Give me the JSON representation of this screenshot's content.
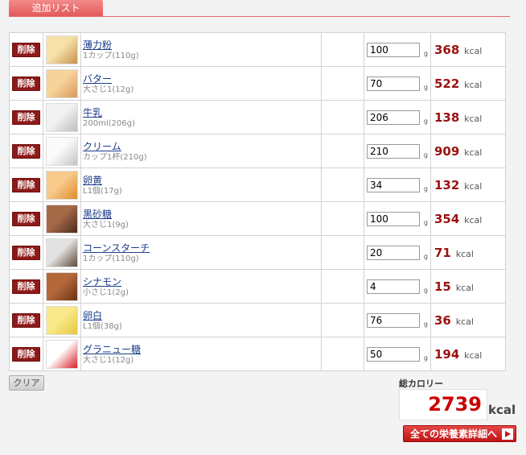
{
  "header": {
    "tab_label": "追加リスト"
  },
  "row_labels": {
    "delete": "削除",
    "unit": "g",
    "kcal_unit": "kcal"
  },
  "items": [
    {
      "name": "薄力粉",
      "sub": "1カップ(110g)",
      "qty": "100",
      "kcal": "368",
      "icon": "flour-bag-icon",
      "colors": [
        "#f6e1a9",
        "#c8914a"
      ]
    },
    {
      "name": "バター",
      "sub": "大さじ1(12g)",
      "qty": "70",
      "kcal": "522",
      "icon": "butter-icon",
      "colors": [
        "#f7d39c",
        "#d99a5b"
      ]
    },
    {
      "name": "牛乳",
      "sub": "200ml(206g)",
      "qty": "206",
      "kcal": "138",
      "icon": "milk-icon",
      "colors": [
        "#f2f2f2",
        "#bdbdbd"
      ]
    },
    {
      "name": "クリーム",
      "sub": "カップ1杯(210g)",
      "qty": "210",
      "kcal": "909",
      "icon": "cream-icon",
      "colors": [
        "#fafafa",
        "#c4c4c4"
      ]
    },
    {
      "name": "卵黄",
      "sub": "L1個(17g)",
      "qty": "34",
      "kcal": "132",
      "icon": "egg-yolk-icon",
      "colors": [
        "#f7c98a",
        "#e08b2b"
      ]
    },
    {
      "name": "黒砂糖",
      "sub": "大さじ1(9g)",
      "qty": "100",
      "kcal": "354",
      "icon": "brown-sugar-icon",
      "colors": [
        "#a46a48",
        "#4d2a1d"
      ]
    },
    {
      "name": "コーンスターチ",
      "sub": "1カップ(110g)",
      "qty": "20",
      "kcal": "71",
      "icon": "cornstarch-icon",
      "colors": [
        "#e2e2e2",
        "#5c4a3a"
      ]
    },
    {
      "name": "シナモン",
      "sub": "小さじ1(2g)",
      "qty": "4",
      "kcal": "15",
      "icon": "cinnamon-icon",
      "colors": [
        "#b4683a",
        "#6b3316"
      ]
    },
    {
      "name": "卵白",
      "sub": "L1個(38g)",
      "qty": "76",
      "kcal": "36",
      "icon": "egg-white-icon",
      "colors": [
        "#f8e98a",
        "#e7c740"
      ]
    },
    {
      "name": "グラニュー糖",
      "sub": "大さじ1(12g)",
      "qty": "50",
      "kcal": "194",
      "icon": "granulated-sugar-icon",
      "colors": [
        "#ffffff",
        "#d61f26"
      ]
    }
  ],
  "footer": {
    "clear_label": "クリア",
    "total_label": "総カロリー",
    "total_value": "2739",
    "total_unit": "kcal",
    "detail_button_label": "全ての栄養素詳細へ"
  }
}
